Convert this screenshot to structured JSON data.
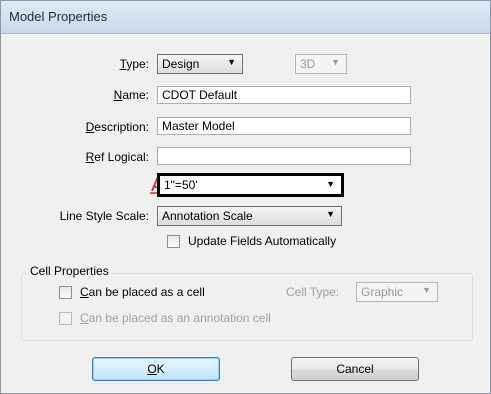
{
  "window": {
    "title": "Model Properties"
  },
  "form": {
    "type": {
      "label": "Type:",
      "mnemonic": "T",
      "rest": "ype:",
      "value": "Design",
      "dimension": "3D"
    },
    "name": {
      "mnemonic": "N",
      "rest": "ame:",
      "value": "CDOT Default"
    },
    "description": {
      "mnemonic": "D",
      "rest": "escription:",
      "value": "Master Model"
    },
    "ref_logical": {
      "mnemonic": "R",
      "rest": "ef Logical:",
      "value": ""
    },
    "annotation_scale": {
      "icon": "annotation-scale-icon",
      "value": "1\"=50'"
    },
    "line_style_scale": {
      "label": "Line Style Scale:",
      "value": "Annotation Scale"
    },
    "update_fields": {
      "label": "Update Fields Automatically",
      "checked": false
    }
  },
  "cell_properties": {
    "group_label": "Cell Properties",
    "can_be_cell": {
      "mnemonic": "C",
      "rest": "an be placed as a cell",
      "checked": false
    },
    "cell_type": {
      "label": "Cell Type:",
      "value": "Graphic"
    },
    "can_be_annotation_cell": {
      "mnemonic": "C",
      "rest": "an be placed as an annotation cell",
      "checked": false
    }
  },
  "buttons": {
    "ok": {
      "mnemonic": "O",
      "rest": "K"
    },
    "cancel": {
      "label": "Cancel"
    }
  },
  "colors": {
    "accent": "#3c7fb1",
    "icon_red": "#c0392b"
  }
}
